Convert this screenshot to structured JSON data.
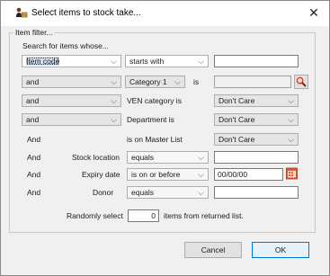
{
  "window": {
    "title": "Select items to stock take...",
    "close_glyph": "✕",
    "icon": "stock-take-icon"
  },
  "filter": {
    "group_label": "Item filter...",
    "search_prompt": "Search for items whose...",
    "row1": {
      "field": "Item code",
      "operator": "starts with",
      "value": ""
    },
    "row2": {
      "connector": "and",
      "field": "Category 1",
      "is_label": "is",
      "value": ""
    },
    "row3": {
      "connector": "and",
      "label": "VEN category is",
      "value": "Don't Care"
    },
    "row4": {
      "connector": "and",
      "label": "Department is",
      "value": "Don't Care"
    },
    "row5": {
      "connector": "And",
      "label": "is on Master List",
      "value": "Don't Care"
    },
    "row6": {
      "connector": "And",
      "label": "Stock location",
      "operator": "equals",
      "value": ""
    },
    "row7": {
      "connector": "And",
      "label": "Expiry date",
      "operator": "is on or before",
      "value": "00/00/00"
    },
    "row8": {
      "connector": "And",
      "label": "Donor",
      "operator": "equals",
      "value": ""
    },
    "random": {
      "prefix": "Randomly select",
      "count": "0",
      "suffix": "items from returned list."
    }
  },
  "buttons": {
    "cancel": "Cancel",
    "ok": "OK"
  },
  "colors": {
    "accent": "#0078d7",
    "calendar": "#e8572b"
  }
}
